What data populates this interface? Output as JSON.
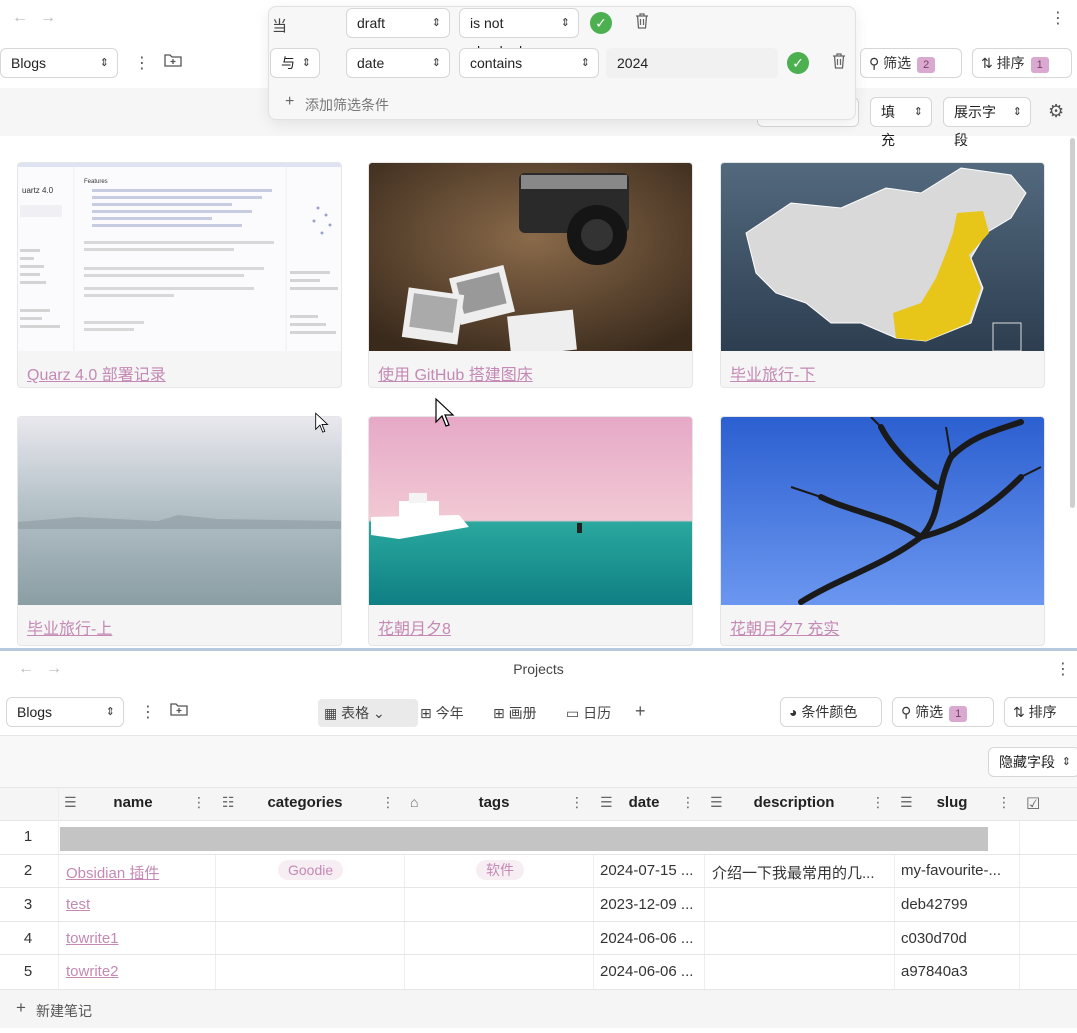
{
  "top": {
    "source_select": "Blogs",
    "filter_badge": "2",
    "filter_label": "筛选",
    "sort_label": "排序",
    "sort_badge": "1",
    "fill_label": "填充",
    "fields_label": "展示字段",
    "filter_popup": {
      "row1": {
        "conj": "当",
        "field": "draft",
        "op": "is not checked"
      },
      "row2": {
        "conj": "与",
        "field": "date",
        "op": "contains",
        "value": "2024"
      },
      "add_label": "添加筛选条件"
    },
    "cards": [
      {
        "title": "Quarz 4.0 部署记录"
      },
      {
        "title": "使用 GitHub 搭建图床"
      },
      {
        "title": "毕业旅行-下"
      },
      {
        "title": "毕业旅行-上"
      },
      {
        "title": "花朝月夕8"
      },
      {
        "title": "花朝月夕7 充实"
      }
    ]
  },
  "bottom": {
    "title": "Projects",
    "source_select": "Blogs",
    "tabs": [
      "表格",
      "今年",
      "画册",
      "日历"
    ],
    "cond_color_label": "条件颜色",
    "filter_label": "筛选",
    "filter_badge": "1",
    "sort_label": "排序",
    "hidden_fields_label": "隐藏字段",
    "columns": [
      "name",
      "categories",
      "tags",
      "date",
      "description",
      "slug"
    ],
    "rows": [
      {
        "num": "1",
        "name": "",
        "category": "",
        "tag": "",
        "date": "",
        "description": "",
        "slug": ""
      },
      {
        "num": "2",
        "name": "Obsidian 插件",
        "category": "Goodie",
        "tag": "软件",
        "date": "2024-07-15 ...",
        "description": "介绍一下我最常用的几...",
        "slug": "my-favourite-..."
      },
      {
        "num": "3",
        "name": "test",
        "category": "",
        "tag": "",
        "date": "2023-12-09 ...",
        "description": "",
        "slug": "deb42799"
      },
      {
        "num": "4",
        "name": "towrite1",
        "category": "",
        "tag": "",
        "date": "2024-06-06 ...",
        "description": "",
        "slug": "c030d70d"
      },
      {
        "num": "5",
        "name": "towrite2",
        "category": "",
        "tag": "",
        "date": "2024-06-06 ...",
        "description": "",
        "slug": "a97840a3"
      }
    ],
    "new_note_label": "新建笔记"
  }
}
